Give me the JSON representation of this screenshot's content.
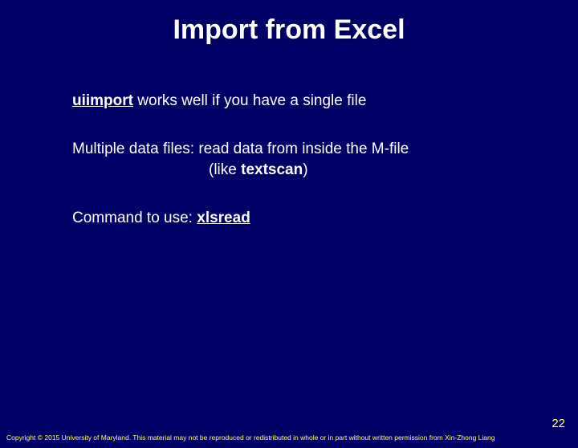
{
  "title": "Import from Excel",
  "line1_bold": "uiimport",
  "line1_rest": " works well if you have a single file",
  "line2": "Multiple data files: read data from inside the M-file",
  "line2_sub_prefix": "(like ",
  "line2_sub_bold": "textscan",
  "line2_sub_suffix": ")",
  "line3_prefix": "Command to use: ",
  "line3_bold": "xlsread",
  "page_number": "22",
  "copyright": "Copyright © 2015 University of Maryland. This material may not be reproduced or redistributed in whole or in part without written permission from Xin-Zhong Liang"
}
